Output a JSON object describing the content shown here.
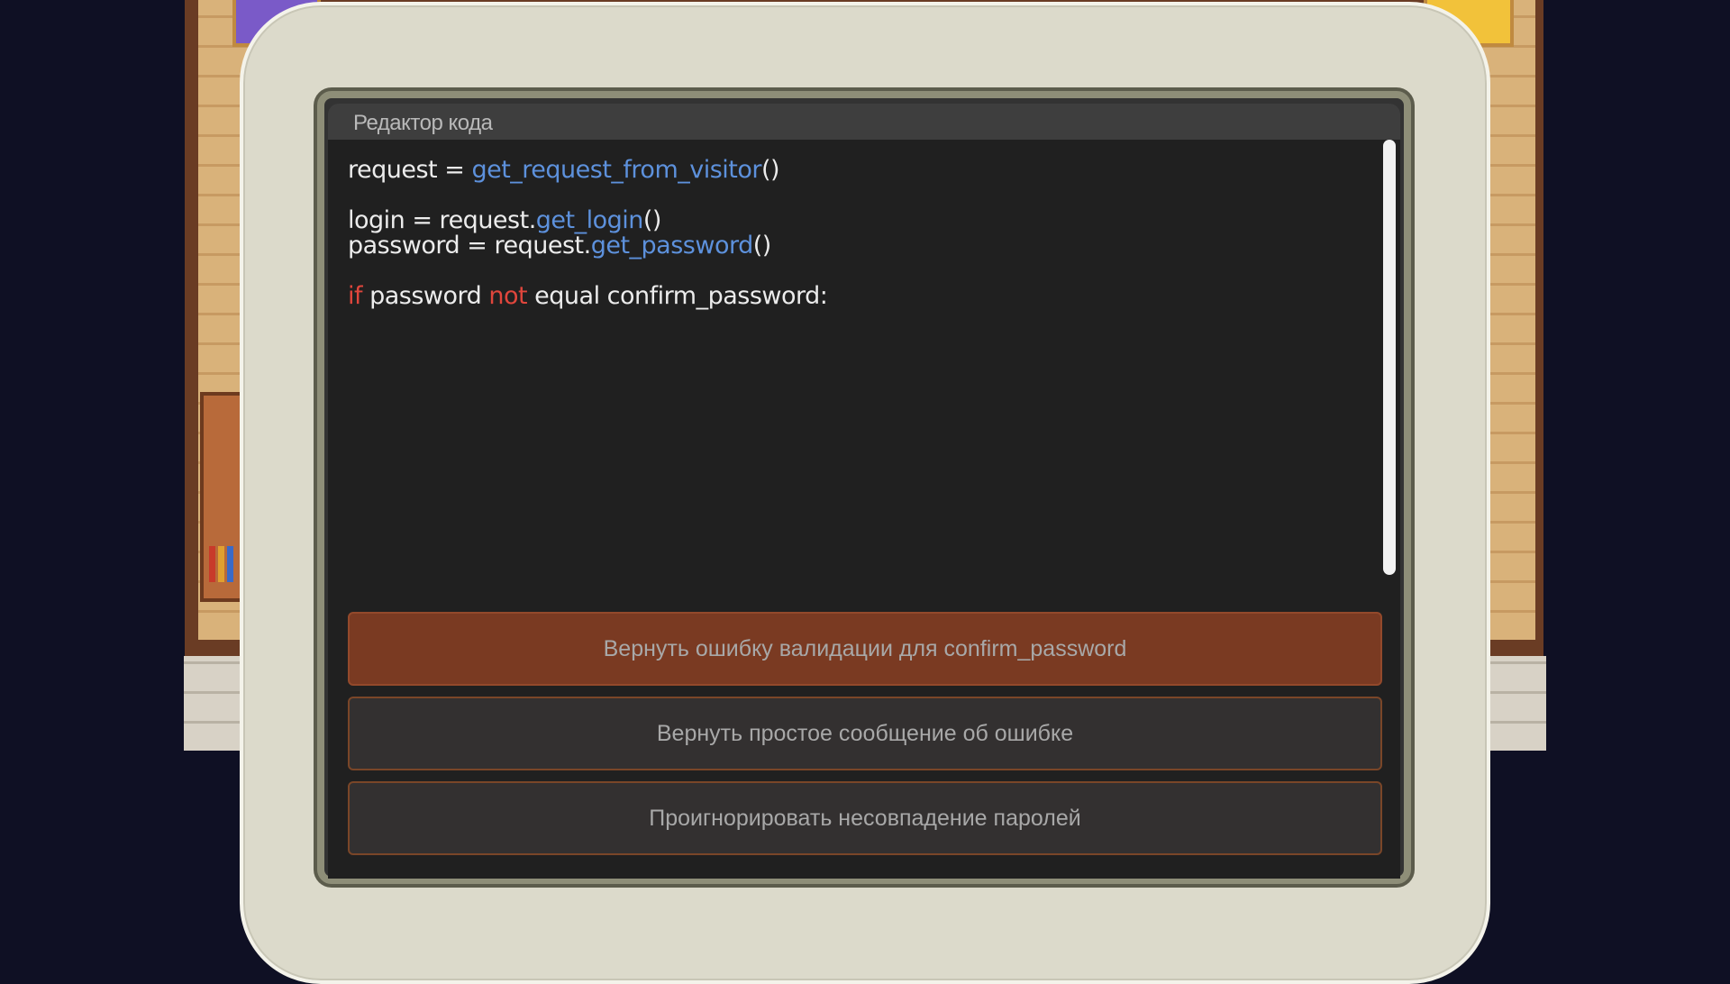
{
  "editor": {
    "title": "Редактор кода"
  },
  "code": {
    "line1": {
      "a": "request = ",
      "b": "get_request_from_visitor",
      "c": "()"
    },
    "line2": {
      "a": "login = request.",
      "b": "get_login",
      "c": "()"
    },
    "line3": {
      "a": "password = request.",
      "b": "get_password",
      "c": "()"
    },
    "line4": {
      "kw1": "if",
      "a": " password ",
      "kw2": "not",
      "b": " equal confirm_password:"
    }
  },
  "choices": [
    {
      "label": "Вернуть ошибку валидации для confirm_password",
      "selected": true
    },
    {
      "label": "Вернуть простое сообщение об ошибке",
      "selected": false
    },
    {
      "label": "Проигнорировать несовпадение паролей",
      "selected": false
    }
  ],
  "colors": {
    "function": "#5d91dc",
    "keyword": "#e0463c",
    "selected_choice": "#7a3a22",
    "background": "#0f1024"
  }
}
